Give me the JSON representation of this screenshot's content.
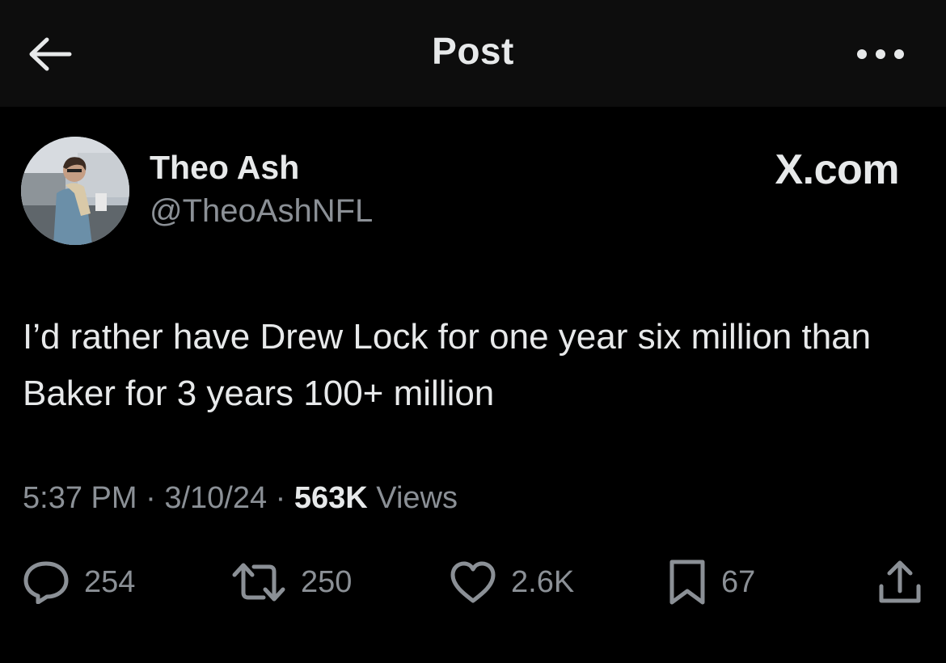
{
  "header": {
    "title": "Post",
    "back_icon": "arrow-left-icon",
    "more_icon": "more-horizontal-icon"
  },
  "post": {
    "author_name": "Theo Ash",
    "author_handle": "@TheoAshNFL",
    "source_label": "X.com",
    "text": "I’d rather have Drew Lock for one year six million than Baker for 3 years 100+ million",
    "time": "5:37 PM",
    "date": "3/10/24",
    "separator": "·",
    "views_count": "563K",
    "views_label": "Views"
  },
  "actions": {
    "replies": "254",
    "reposts": "250",
    "likes": "2.6K",
    "bookmarks": "67"
  },
  "colors": {
    "background": "#000000",
    "header_background": "#0d0d0d",
    "primary_text": "#e7e9ea",
    "secondary_text": "#8b9096"
  }
}
